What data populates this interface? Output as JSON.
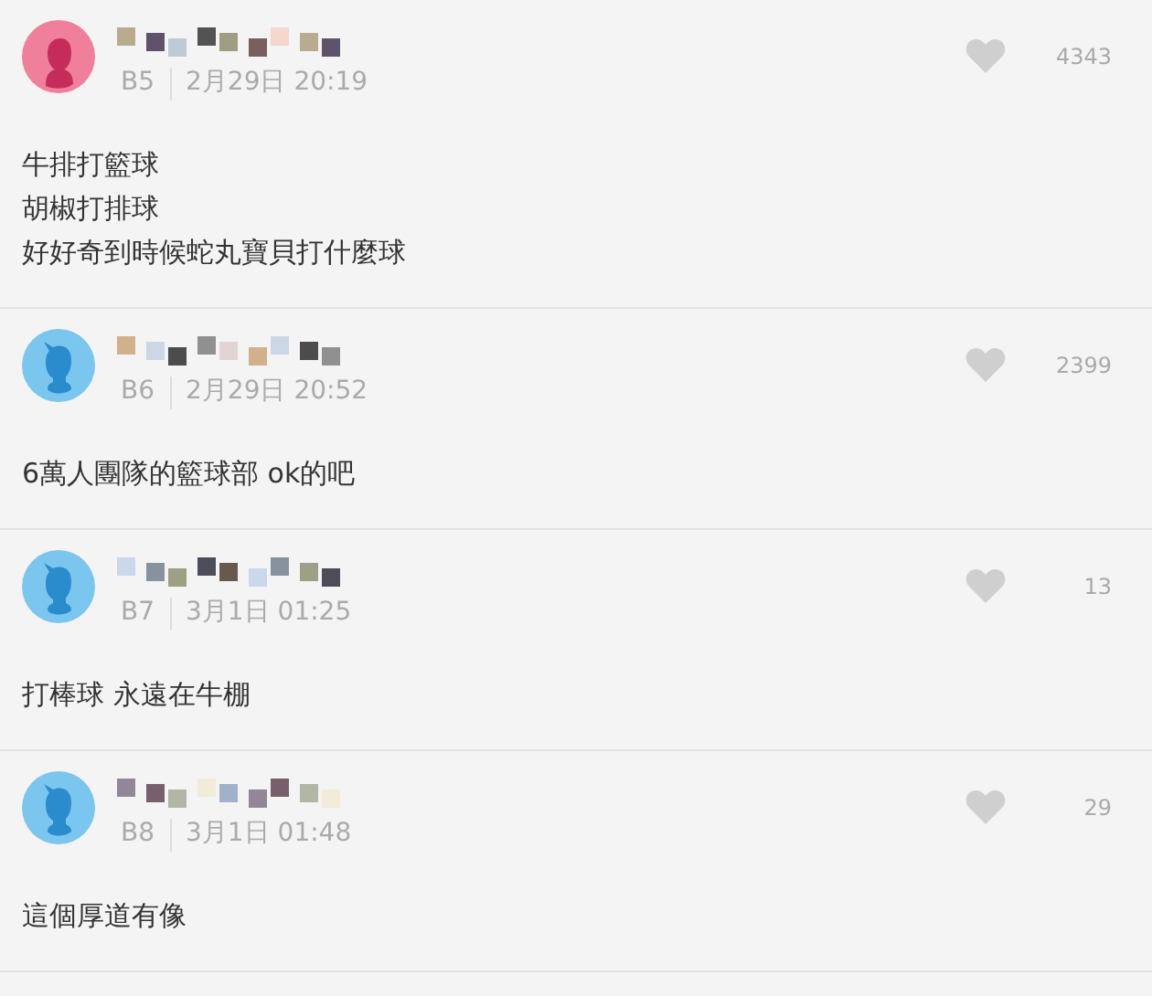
{
  "comments": [
    {
      "avatar": {
        "kind": "female"
      },
      "floor": "B5",
      "time": "2月29日 20:19",
      "likes": "4343",
      "lines": [
        "牛排打籃球",
        "胡椒打排球",
        "好好奇到時候蛇丸寶貝打什麼球"
      ]
    },
    {
      "avatar": {
        "kind": "male"
      },
      "floor": "B6",
      "time": "2月29日 20:52",
      "likes": "2399",
      "lines": [
        "6萬人團隊的籃球部 ok的吧"
      ]
    },
    {
      "avatar": {
        "kind": "male"
      },
      "floor": "B7",
      "time": "3月1日 01:25",
      "likes": "13",
      "lines": [
        "打棒球 永遠在牛棚"
      ]
    },
    {
      "avatar": {
        "kind": "male"
      },
      "floor": "B8",
      "time": "3月1日 01:48",
      "likes": "29",
      "lines": [
        "這個厚道有像"
      ]
    }
  ]
}
